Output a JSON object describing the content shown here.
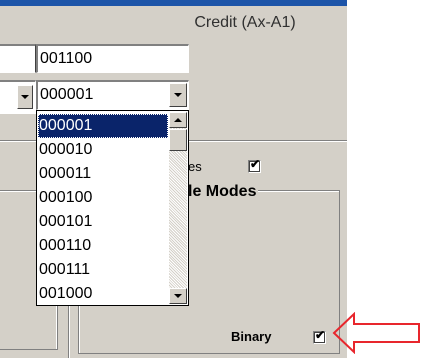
{
  "header": {
    "label": "Credit (Ax-A1)"
  },
  "credit_field": {
    "value": "001100"
  },
  "credit_combo": {
    "selected": "000001"
  },
  "dropdown": {
    "options": [
      "000001",
      "000010",
      "000011",
      "000100",
      "000101",
      "000110",
      "000111",
      "001000"
    ],
    "selected_index": 0
  },
  "group": {
    "title_partial": "le Modes",
    "partial_label": "es",
    "top_checkbox_checked": true,
    "binary_label": "Binary",
    "binary_checked": true
  },
  "colors": {
    "panel_bg": "#d4d0c8",
    "selection": "#0a246a",
    "title_bar": "#1c54a8",
    "annotation_arrow": "#e8262d"
  },
  "icons": {
    "check": "✔",
    "annotation": "red-arrow-icon"
  }
}
